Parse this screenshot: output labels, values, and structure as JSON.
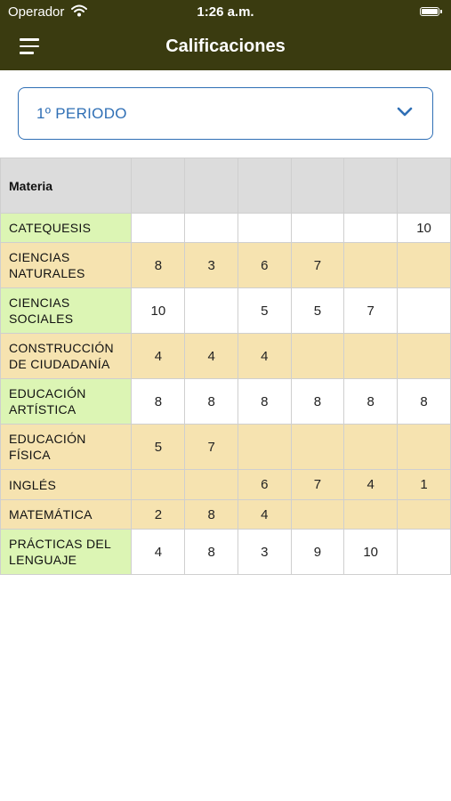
{
  "status_bar": {
    "carrier": "Operador",
    "time": "1:26 a.m.",
    "wifi_icon": "wifi-icon",
    "battery_icon": "battery-icon"
  },
  "header": {
    "title": "Calificaciones",
    "menu_icon": "hamburger-menu-icon",
    "background_color": "#3a3b10"
  },
  "period_selector": {
    "selected": "1º PERIODO",
    "icon": "chevron-down-icon",
    "accent_color": "#2f6fb5"
  },
  "grades_table": {
    "subject_header": "Materia",
    "grade_headers": [
      "",
      "",
      "",
      "",
      "",
      ""
    ],
    "rows": [
      {
        "subject": "CATEQUESIS",
        "grades": [
          "",
          "",
          "",
          "",
          "",
          "10"
        ]
      },
      {
        "subject": "CIENCIAS NATURALES",
        "grades": [
          "8",
          "3",
          "6",
          "7",
          "",
          ""
        ]
      },
      {
        "subject": "CIENCIAS SOCIALES",
        "grades": [
          "10",
          "",
          "5",
          "5",
          "7",
          ""
        ]
      },
      {
        "subject": "CONSTRUCCIÓN DE CIUDADANÍA",
        "grades": [
          "4",
          "4",
          "4",
          "",
          "",
          ""
        ]
      },
      {
        "subject": "EDUCACIÓN ARTÍSTICA",
        "grades": [
          "8",
          "8",
          "8",
          "8",
          "8",
          "8"
        ]
      },
      {
        "subject": "EDUCACIÓN FÍSICA",
        "grades": [
          "5",
          "7",
          "",
          "",
          "",
          ""
        ]
      },
      {
        "subject": "INGLÉS",
        "grades": [
          "",
          "",
          "6",
          "7",
          "4",
          "1"
        ]
      },
      {
        "subject": "MATEMÁTICA",
        "grades": [
          "2",
          "8",
          "4",
          "",
          "",
          ""
        ]
      },
      {
        "subject": "PRÁCTICAS DEL LENGUAJE",
        "grades": [
          "4",
          "8",
          "3",
          "9",
          "10",
          ""
        ]
      }
    ],
    "colors": {
      "header_bg": "#dcdcdc",
      "subject_bg": "#dcf5b4",
      "striped_row_bg": "#f6e3b0",
      "plain_row_bg": "#ffffff"
    }
  }
}
